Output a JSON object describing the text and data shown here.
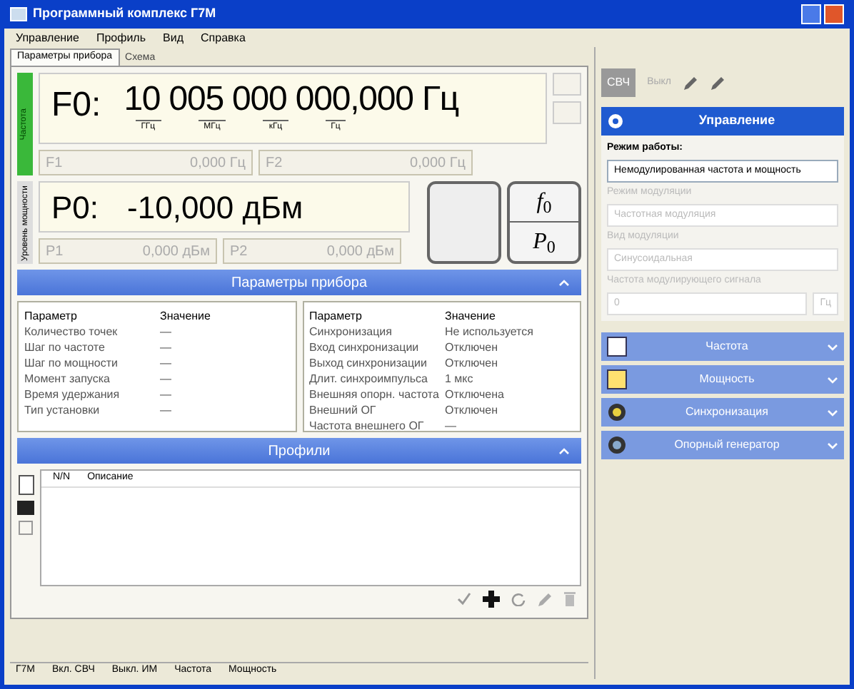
{
  "window": {
    "title": "Программный комплекс Г7М"
  },
  "menu": [
    "Управление",
    "Профиль",
    "Вид",
    "Справка"
  ],
  "tabs": [
    {
      "label": "Параметры прибора",
      "selected": true
    },
    {
      "label": "Схема",
      "selected": false
    }
  ],
  "frequency": {
    "side_label": "Частота",
    "name": "F0:",
    "value": "10 005 000 000,000",
    "unit": "Гц",
    "digit_units": [
      "ГГц",
      "МГц",
      "кГц",
      "Гц"
    ],
    "secondary": [
      {
        "name": "F1",
        "value": "0,000 Гц"
      },
      {
        "name": "F2",
        "value": "0,000 Гц"
      }
    ]
  },
  "power": {
    "side_label": "Уровень мощности",
    "name": "P0:",
    "value": "-10,000 дБм",
    "secondary": [
      {
        "name": "P1",
        "value": "0,000 дБм"
      },
      {
        "name": "P2",
        "value": "0,000 дБм"
      }
    ]
  },
  "mode_button": {
    "top": "*f*$_{0}$",
    "bottom": "*P*$_{0}$"
  },
  "parameters": {
    "title": "Параметры прибора",
    "tables": [
      {
        "columns": [
          "Параметр",
          "Значение"
        ],
        "rows": [
          [
            "Количество точек",
            "—"
          ],
          [
            "Шаг по частоте",
            "—"
          ],
          [
            "Шаг по мощности",
            "—"
          ],
          [
            "Момент запуска",
            "—"
          ],
          [
            "Время удержания",
            "—"
          ],
          [
            "Тип установки",
            "—"
          ]
        ]
      },
      {
        "columns": [
          "Параметр",
          "Значение"
        ],
        "rows": [
          [
            "Синхронизация",
            "Не используется"
          ],
          [
            "Вход синхронизации",
            "Отключен"
          ],
          [
            "Выход синхронизации",
            "Отключен"
          ],
          [
            "Длит. синхроимпульса",
            "1 мкс"
          ],
          [
            "Внешняя опорн. частота",
            "Отключена"
          ],
          [
            "Внешний ОГ",
            "Отключен"
          ],
          [
            "Частота внешнего ОГ",
            "—"
          ]
        ]
      }
    ]
  },
  "profiles": {
    "title": "Профили",
    "columns": [
      "N/N",
      "Описание"
    ]
  },
  "status_bar": [
    "Г7М",
    "Вкл. СВЧ",
    "Выкл. ИМ",
    "Частота",
    "Мощность"
  ],
  "toolbar": {
    "label": "СВЧ",
    "state": "Выкл"
  },
  "control": {
    "title": "Управление",
    "mode_label": "Режим работы:",
    "mode_value": "Немодулированная частота и мощность",
    "fields": [
      {
        "label": "Режим модуляции",
        "value": "Частотная модуляция"
      },
      {
        "label": "Вид модуляции",
        "value": "Синусоидальная"
      }
    ],
    "last_label": "Частота модулирующего сигнала",
    "last_value": "0",
    "last_unit": "Гц"
  },
  "sections": [
    {
      "title": "Частота",
      "kind": "f"
    },
    {
      "title": "Мощность",
      "kind": "p"
    },
    {
      "title": "Синхронизация",
      "kind": "sync"
    },
    {
      "title": "Опорный генератор",
      "kind": "ref"
    }
  ]
}
